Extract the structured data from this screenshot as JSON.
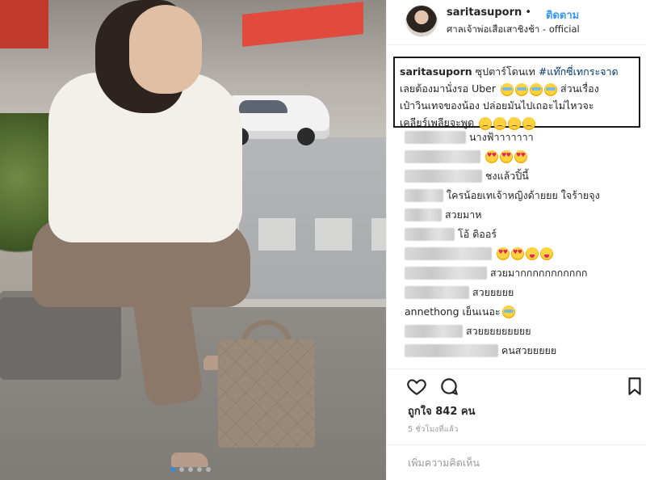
{
  "photo": {
    "alt_subject": "",
    "carousel": {
      "count": 5,
      "active_index": 0
    }
  },
  "post_header": {
    "username": "saritasuporn",
    "bullet": " •",
    "follow_label": "ติดตาม",
    "location": "ศาลเจ้าพ่อเสือเสาชิงช้า - official"
  },
  "caption": {
    "username": "saritasuporn",
    "text_1": "ซุปตาร์โดนเท",
    "hashtag": "#แท๊กซี่เทกระจาด",
    "text_2": "เลยต้องมานั่งรอ Uber",
    "text_3": "ส่วนเรื่อง",
    "text_4": "เป๋าวินเทจของน้อง ปล่อยมันไปเถอะไม่ไหวจะ",
    "text_5": "เคลียร์เพลียจะพูด"
  },
  "comments": [
    {
      "text": "นางฟ้าาาาาาา",
      "blur_width": 76,
      "emojis": []
    },
    {
      "text": "",
      "blur_width": 94,
      "emojis": [
        "heart",
        "heart",
        "heart"
      ]
    },
    {
      "text": "ชงแล้วปิ้นี้",
      "blur_width": 96,
      "emojis": []
    },
    {
      "text": "ใครน้อยเทเจ้าหญิงด้ายยย ใจร้ายจุง",
      "blur_width": 48,
      "emojis": []
    },
    {
      "text": "สวยมาห",
      "blur_width": 46,
      "emojis": []
    },
    {
      "text": "โอ้ ดิออร์",
      "blur_width": 62,
      "emojis": []
    },
    {
      "text": "",
      "blur_width": 108,
      "emojis": [
        "heart",
        "heart",
        "yum",
        "yum"
      ]
    },
    {
      "text": "สวยมากกกกกกกกกกก",
      "blur_width": 102,
      "emojis": []
    },
    {
      "text": "สวยยยยย",
      "blur_width": 80,
      "emojis": []
    },
    {
      "text": "annethong เย็นเนอะ",
      "blur_width": 0,
      "emojis": [
        "cry"
      ]
    },
    {
      "text": "สวยยยยยยยยย",
      "blur_width": 72,
      "emojis": []
    },
    {
      "text": "คนสวยยยยย",
      "blur_width": 116,
      "emojis": []
    }
  ],
  "likes": {
    "label": "ถูกใจ",
    "count": "842",
    "unit": "คน"
  },
  "time_ago": "5 ชั่วโมงที่แล้ว",
  "add_comment": {
    "placeholder": "เพิ่มความคิดเห็น"
  },
  "icons": {
    "like": "heart-outline-icon",
    "comment": "comment-bubble-icon",
    "save": "bookmark-icon"
  }
}
